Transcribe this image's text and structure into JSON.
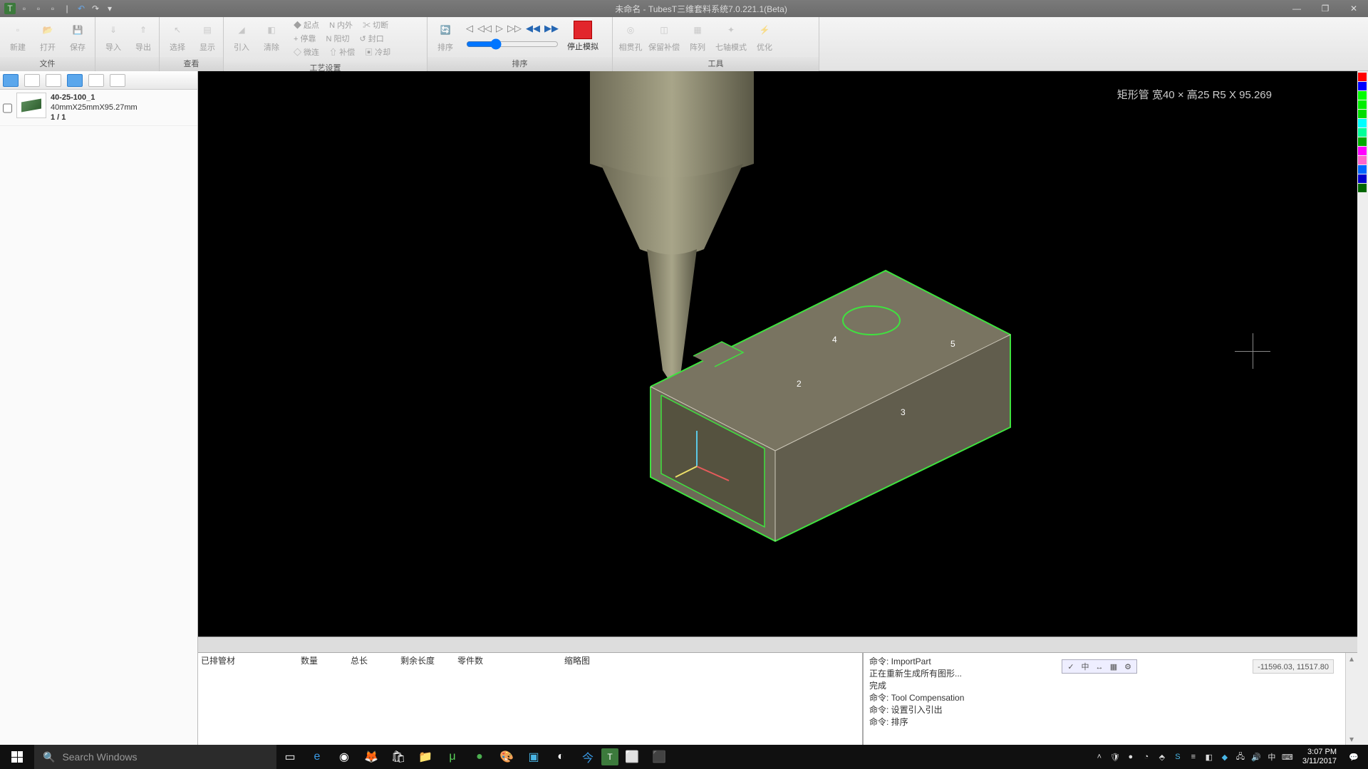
{
  "title": "未命名 - TubesT三维套料系统7.0.221.1(Beta)",
  "ribbon_groups": {
    "file": {
      "label": "文件",
      "buttons": [
        "新建",
        "打开",
        "保存",
        "",
        "导入",
        "导出"
      ]
    },
    "view": {
      "label": "查看",
      "buttons": [
        "选择",
        "显示"
      ]
    },
    "tech": {
      "label": "工艺设置",
      "large": [
        "引入",
        "清除"
      ],
      "small": [
        "◆ 起点",
        "N 内外",
        "✂ 切断",
        "+ 停靠",
        "N 阳切",
        "↺ 封口",
        "◇ 微连",
        "⇧ 补偿",
        "▣ 冷却"
      ]
    },
    "sort": {
      "label": "排序",
      "buttons": {
        "auto": "排序",
        "stop": "停止模拟"
      }
    },
    "tools": {
      "label": "工具",
      "buttons": [
        "相贯孔",
        "保留补偿",
        "阵列",
        "七轴模式",
        "优化"
      ]
    }
  },
  "part": {
    "name": "40-25-100_1",
    "dims": "40mmX25mmX95.27mm",
    "count": "1 / 1"
  },
  "viewport": {
    "info": "矩形管 宽40 × 高25 R5 X 95.269",
    "labels": {
      "two": "2",
      "three": "3",
      "four": "4",
      "five": "5"
    }
  },
  "table_headers": [
    "已排管材",
    "数量",
    "总长",
    "剩余长度",
    "零件数",
    "缩略图"
  ],
  "log": [
    "命令: ImportPart",
    "正在重新生成所有图形...",
    "完成",
    "命令: Tool Compensation",
    "命令: 设置引入引出",
    "命令: 排序"
  ],
  "status_icons": [
    "✓",
    "中",
    "↔",
    "▦",
    "⚙"
  ],
  "coords": "-11596.03, 11517.80",
  "taskbar": {
    "search_placeholder": "Search Windows",
    "time": "3:07 PM",
    "date": "3/11/2017"
  },
  "colors": [
    "#ff0000",
    "#0000ff",
    "#00ff00",
    "#00ff00",
    "#00ff00",
    "#00ffff",
    "#00ff80",
    "#00cc00",
    "#ff00ff",
    "#ff66cc",
    "#0066ff",
    "#0000cc",
    "#006600"
  ]
}
